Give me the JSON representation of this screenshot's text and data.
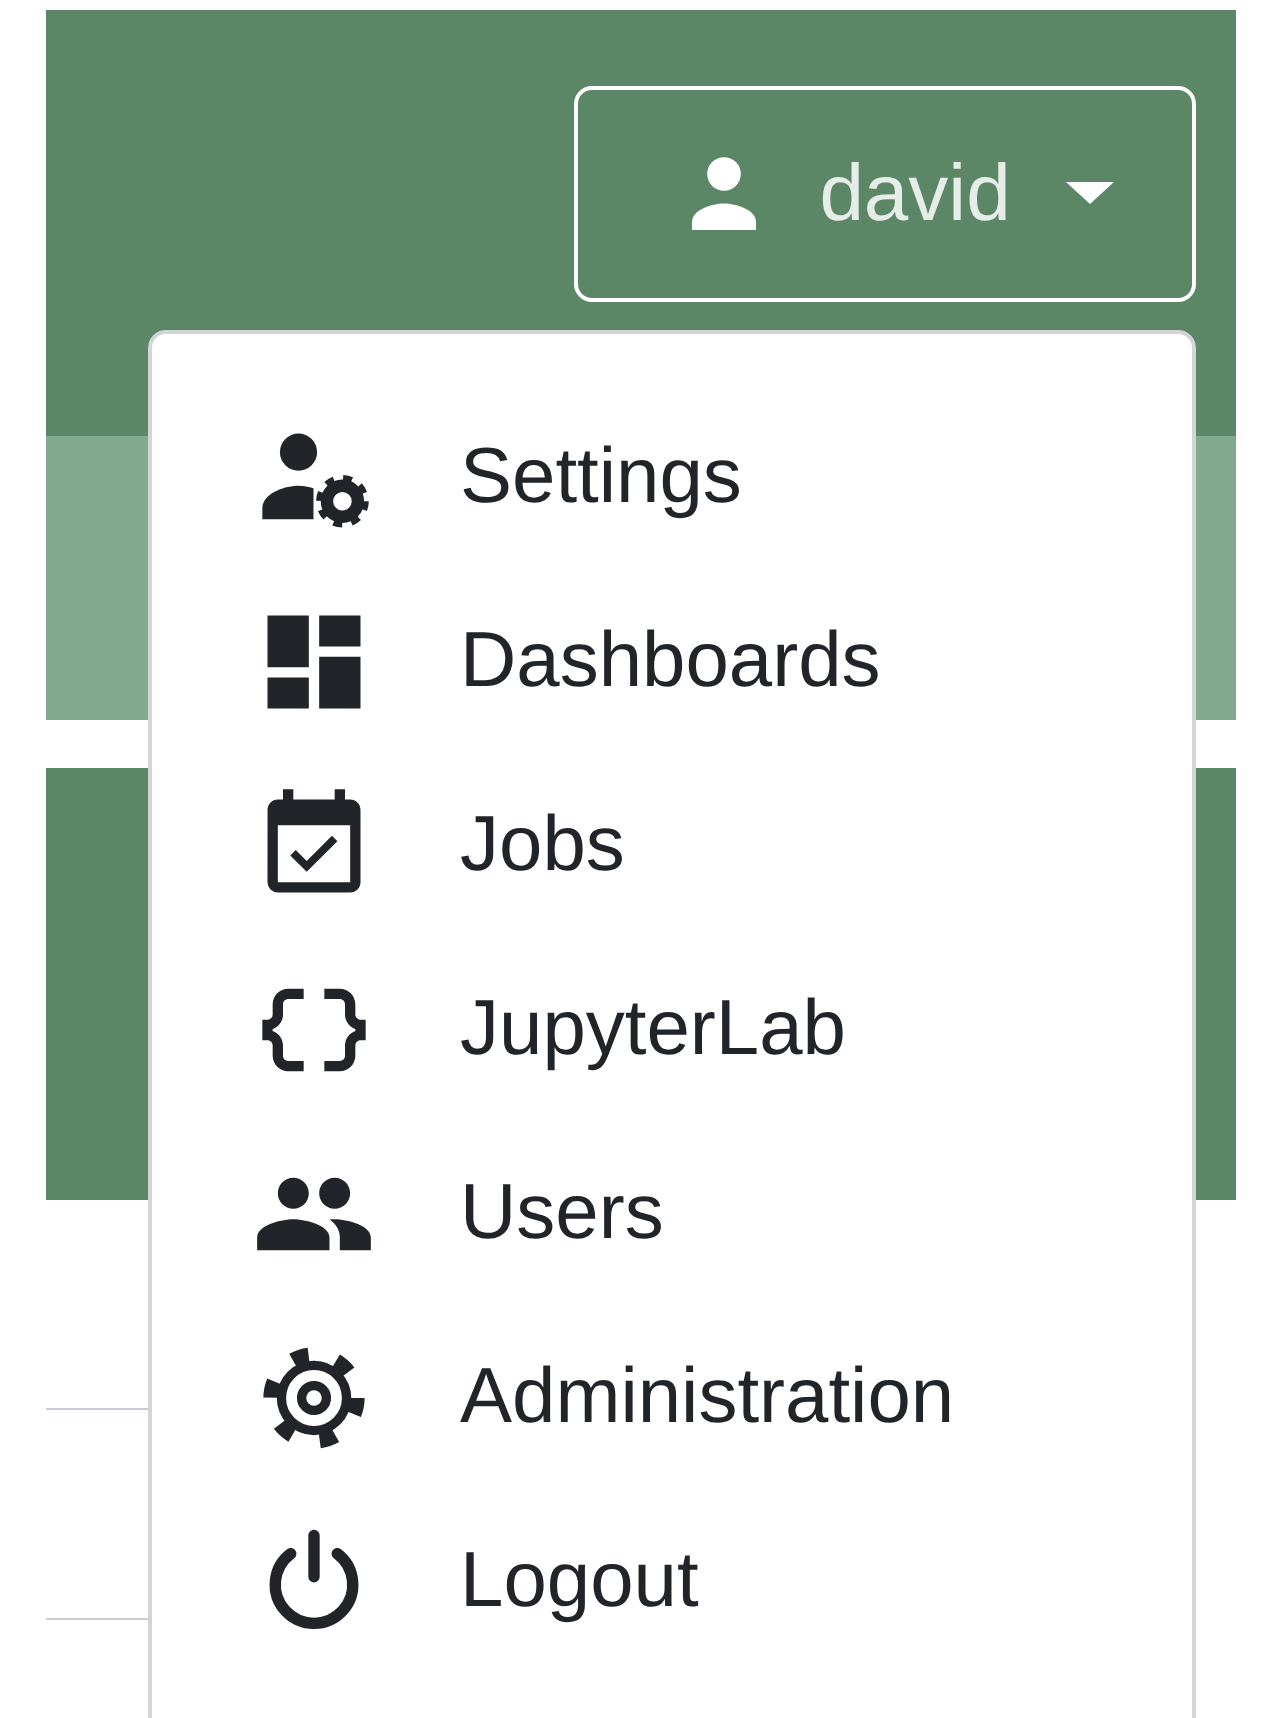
{
  "user_button": {
    "label": "david",
    "expanded": true
  },
  "menu": {
    "items": [
      {
        "label": "Settings"
      },
      {
        "label": "Dashboards"
      },
      {
        "label": "Jobs"
      },
      {
        "label": "JupyterLab"
      },
      {
        "label": "Users"
      },
      {
        "label": "Administration"
      },
      {
        "label": "Logout"
      }
    ]
  }
}
